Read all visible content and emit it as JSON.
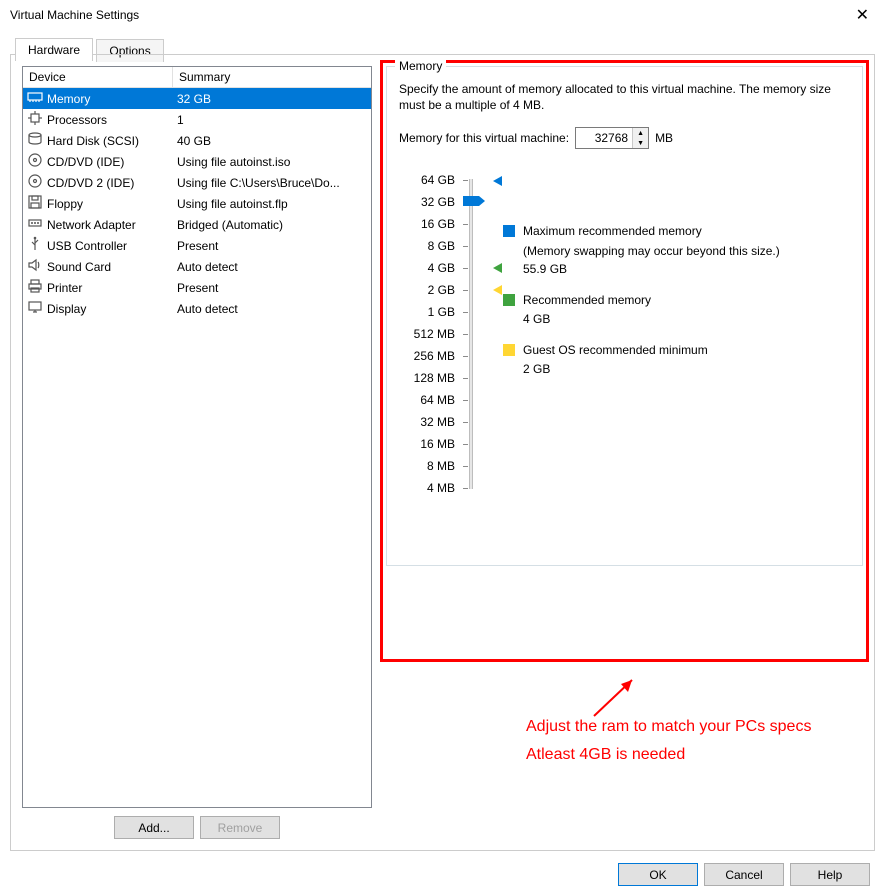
{
  "title": "Virtual Machine Settings",
  "tabs": {
    "hardware": "Hardware",
    "options": "Options"
  },
  "columns": {
    "device": "Device",
    "summary": "Summary"
  },
  "devices": [
    {
      "name": "Memory",
      "summary": "32 GB",
      "icon": "memory"
    },
    {
      "name": "Processors",
      "summary": "1",
      "icon": "cpu"
    },
    {
      "name": "Hard Disk (SCSI)",
      "summary": "40 GB",
      "icon": "hdd"
    },
    {
      "name": "CD/DVD (IDE)",
      "summary": "Using file autoinst.iso",
      "icon": "disc"
    },
    {
      "name": "CD/DVD 2 (IDE)",
      "summary": "Using file C:\\Users\\Bruce\\Do...",
      "icon": "disc"
    },
    {
      "name": "Floppy",
      "summary": "Using file autoinst.flp",
      "icon": "floppy"
    },
    {
      "name": "Network Adapter",
      "summary": "Bridged (Automatic)",
      "icon": "net"
    },
    {
      "name": "USB Controller",
      "summary": "Present",
      "icon": "usb"
    },
    {
      "name": "Sound Card",
      "summary": "Auto detect",
      "icon": "sound"
    },
    {
      "name": "Printer",
      "summary": "Present",
      "icon": "printer"
    },
    {
      "name": "Display",
      "summary": "Auto detect",
      "icon": "display"
    }
  ],
  "buttons": {
    "add": "Add...",
    "remove": "Remove",
    "ok": "OK",
    "cancel": "Cancel",
    "help": "Help"
  },
  "memory": {
    "group_title": "Memory",
    "desc": "Specify the amount of memory allocated to this virtual machine. The memory size must be a multiple of 4 MB.",
    "input_label": "Memory for this virtual machine:",
    "value": "32768",
    "unit": "MB",
    "ticks": [
      "64 GB",
      "32 GB",
      "16 GB",
      "8 GB",
      "4 GB",
      "2 GB",
      "1 GB",
      "512 MB",
      "256 MB",
      "128 MB",
      "64 MB",
      "32 MB",
      "16 MB",
      "8 MB",
      "4 MB"
    ],
    "legend": {
      "max_label": "Maximum recommended memory",
      "max_note": "(Memory swapping may occur beyond this size.)",
      "max_val": "55.9 GB",
      "rec_label": "Recommended memory",
      "rec_val": "4 GB",
      "min_label": "Guest OS recommended minimum",
      "min_val": "2 GB"
    }
  },
  "annotation": {
    "line1": "Adjust the ram to match your PCs specs",
    "line2": "Atleast 4GB is needed"
  }
}
